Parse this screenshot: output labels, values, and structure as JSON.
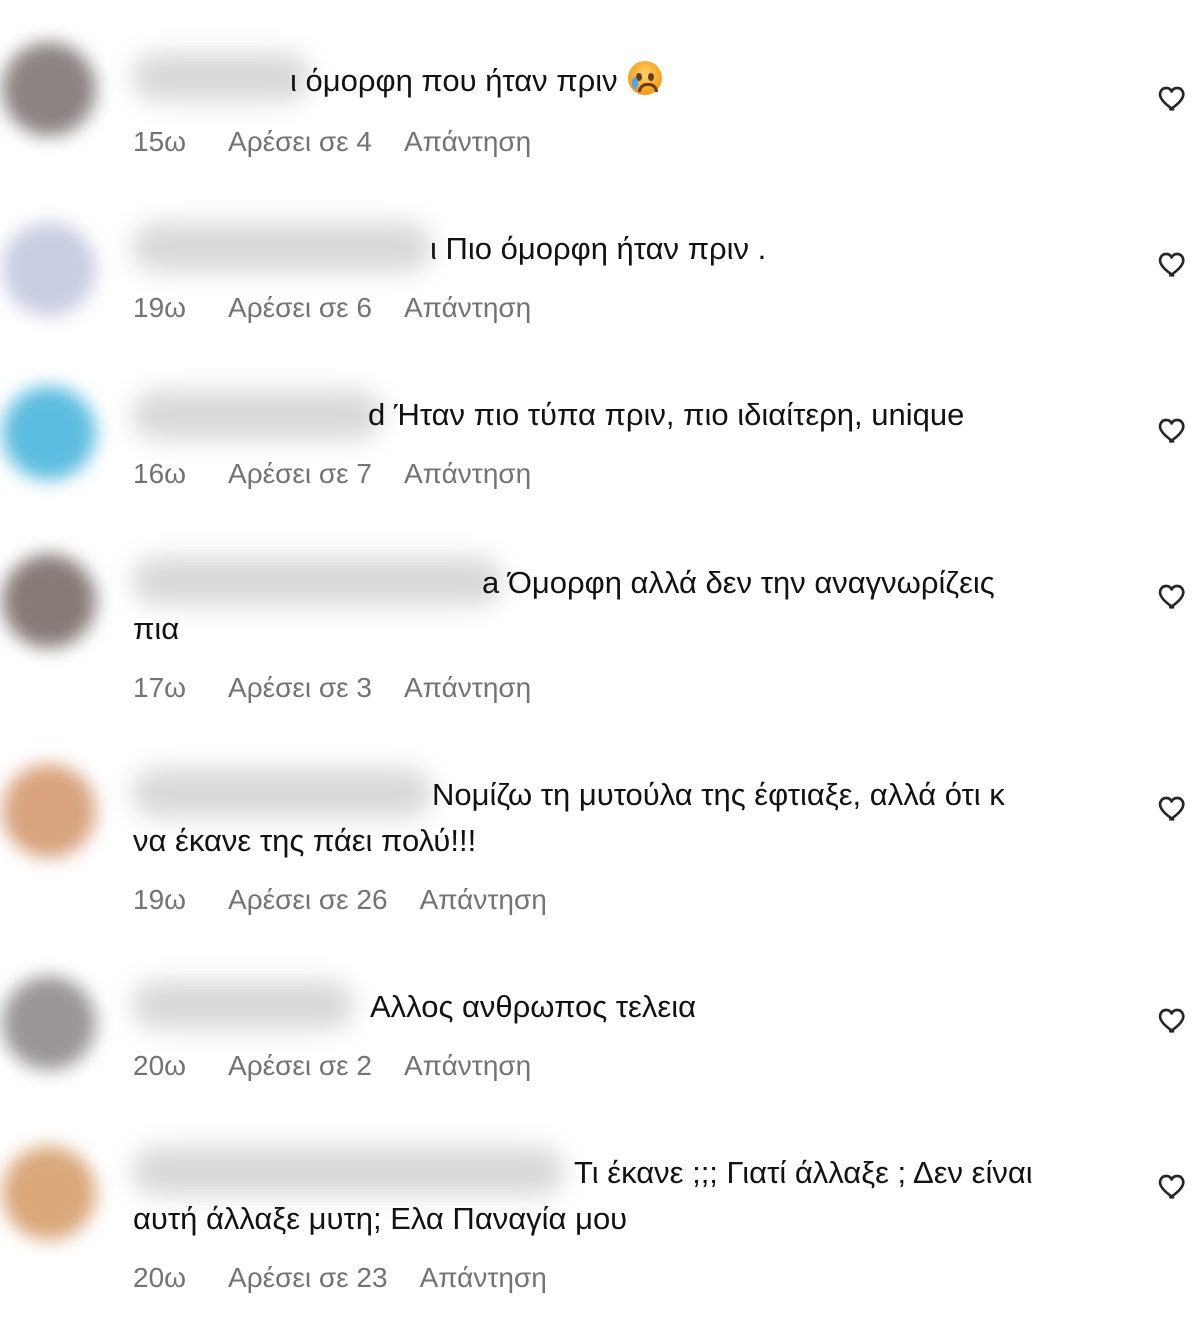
{
  "comments": [
    {
      "text": "ι όμορφη που ήταν πριν",
      "continuation": "",
      "emoji": "crying-face",
      "time": "15ω",
      "likes": "Αρέσει σε 4",
      "reply": "Απάντηση",
      "avatar_color": "#8c8382"
    },
    {
      "text": "ι Πιο όμορφη ήταν πριν .",
      "continuation": "",
      "time": "19ω",
      "likes": "Αρέσει σε 6",
      "reply": "Απάντηση",
      "avatar_color": "#c9cde2"
    },
    {
      "text": "d Ήταν πιο τύπα πριν, πιο ιδιαίτερη, unique",
      "continuation": "",
      "time": "16ω",
      "likes": "Αρέσει σε 7",
      "reply": "Απάντηση",
      "avatar_color": "#5dbde0"
    },
    {
      "text": "a Όμορφη αλλά δεν την αναγνωρίζεις",
      "continuation": "πια",
      "time": "17ω",
      "likes": "Αρέσει σε 3",
      "reply": "Απάντηση",
      "avatar_color": "#877b78"
    },
    {
      "text": "Νομίζω τη μυτούλα της έφτιαξε, αλλά ότι κ",
      "continuation": "να έκανε της πάει πολύ!!!",
      "time": "19ω",
      "likes": "Αρέσει σε 26",
      "reply": "Απάντηση",
      "avatar_color": "#d8a37e"
    },
    {
      "text": "Αλλος ανθρωπος τελεια",
      "continuation": "",
      "time": "20ω",
      "likes": "Αρέσει σε 2",
      "reply": "Απάντηση",
      "avatar_color": "#9a9698"
    },
    {
      "text": "Τι έκανε ;;; Γιατί άλλαξε ; Δεν είναι",
      "continuation": "αυτή άλλαξε μυτη; Ελα Παναγία μου",
      "time": "20ω",
      "likes": "Αρέσει σε 23",
      "reply": "Απάντηση",
      "avatar_color": "#d9a77a"
    }
  ]
}
